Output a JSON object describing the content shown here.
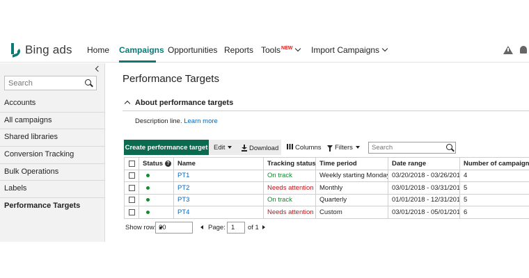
{
  "header": {
    "logo_text": "Bing ads",
    "nav": [
      {
        "label": "Home"
      },
      {
        "label": "Campaigns",
        "active": true
      },
      {
        "label": "Opportunities"
      },
      {
        "label": "Reports"
      },
      {
        "label": "Tools",
        "badge": "NEW"
      },
      {
        "label": "Import Campaigns"
      }
    ]
  },
  "sidebar": {
    "search_placeholder": "Search",
    "items": [
      {
        "label": "Accounts"
      },
      {
        "label": "All campaigns"
      },
      {
        "label": "Shared libraries"
      },
      {
        "label": "Conversion Tracking"
      },
      {
        "label": "Bulk Operations"
      },
      {
        "label": "Labels"
      },
      {
        "label": "Performance Targets",
        "active": true
      }
    ]
  },
  "main": {
    "title": "Performance Targets",
    "about": {
      "title": "About performance targets",
      "description": "Description line.",
      "link": "Learn more"
    },
    "toolbar": {
      "create": "Create performance target",
      "edit": "Edit",
      "download": "Download",
      "columns": "Columns",
      "filters": "Filters",
      "search_placeholder": "Search"
    },
    "table": {
      "columns": [
        "Status",
        "Name",
        "Tracking status",
        "Time period",
        "Date range",
        "Number of campaigns"
      ],
      "rows": [
        {
          "name": "PT1",
          "tracking": "On track",
          "tracking_state": "ok",
          "period": "Weekly starting Monday",
          "range": "03/20/2018 - 03/26/2018",
          "count": "4"
        },
        {
          "name": "PT2",
          "tracking": "Needs attention",
          "tracking_state": "bad",
          "period": "Monthly",
          "range": "03/01/2018 - 03/31/2018",
          "count": "5"
        },
        {
          "name": "PT3",
          "tracking": "On track",
          "tracking_state": "ok",
          "period": "Quarterly",
          "range": "01/01/2018 - 12/31/2018",
          "count": "5"
        },
        {
          "name": "PT4",
          "tracking": "Needs attention",
          "tracking_state": "bad",
          "period": "Custom",
          "range": "03/01/2018 - 05/01/2018",
          "count": "6"
        }
      ]
    },
    "pager": {
      "show_row_label": "Show row:",
      "rows_value": "20",
      "page_label": "Page:",
      "page_value": "1",
      "of_label": "of 1"
    }
  },
  "colors": {
    "brand": "#0b7a75",
    "primary_button": "#0b6b51",
    "on_track": "#128a2e",
    "needs_attention": "#c0141b",
    "link": "#0b64b4"
  }
}
